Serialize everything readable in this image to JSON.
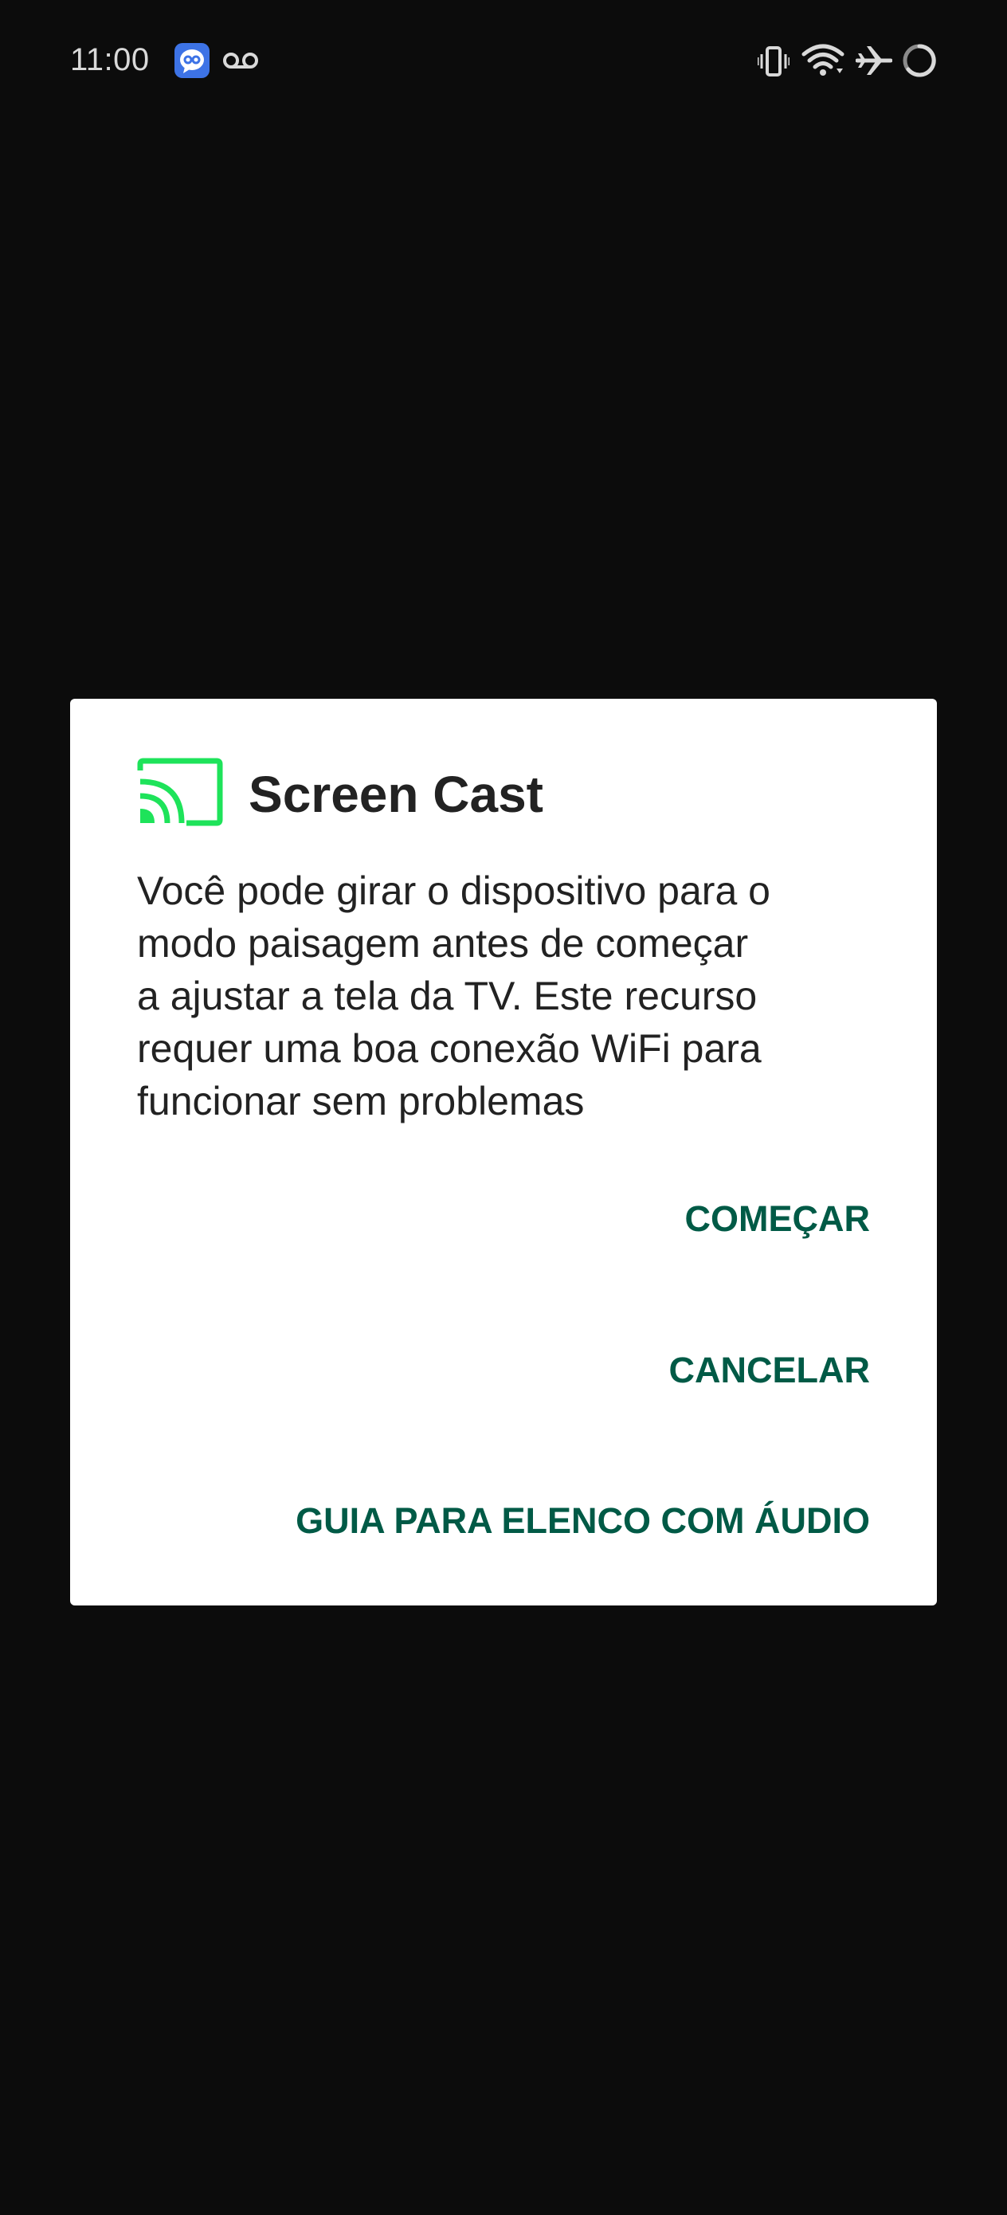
{
  "status_bar": {
    "time": "11:00",
    "left_icons": [
      "messenger-app-icon",
      "voicemail-icon"
    ],
    "right_icons": [
      "vibrate-icon",
      "wifi-icon",
      "airplane-mode-icon",
      "battery-charging-icon"
    ]
  },
  "dialog": {
    "icon": "cast-icon",
    "icon_color": "#1ee35a",
    "title": "Screen Cast",
    "message_lines": [
      "Você pode girar o dispositivo para o",
      "modo paisagem antes de começar",
      "a ajustar a tela da TV. Este recurso",
      "requer uma boa conexão WiFi para",
      "funcionar sem problemas"
    ],
    "actions": {
      "start": "COMEÇAR",
      "cancel": "CANCELAR",
      "audio_guide": "GUIA PARA ELENCO COM ÁUDIO"
    },
    "action_color": "#005a46"
  }
}
